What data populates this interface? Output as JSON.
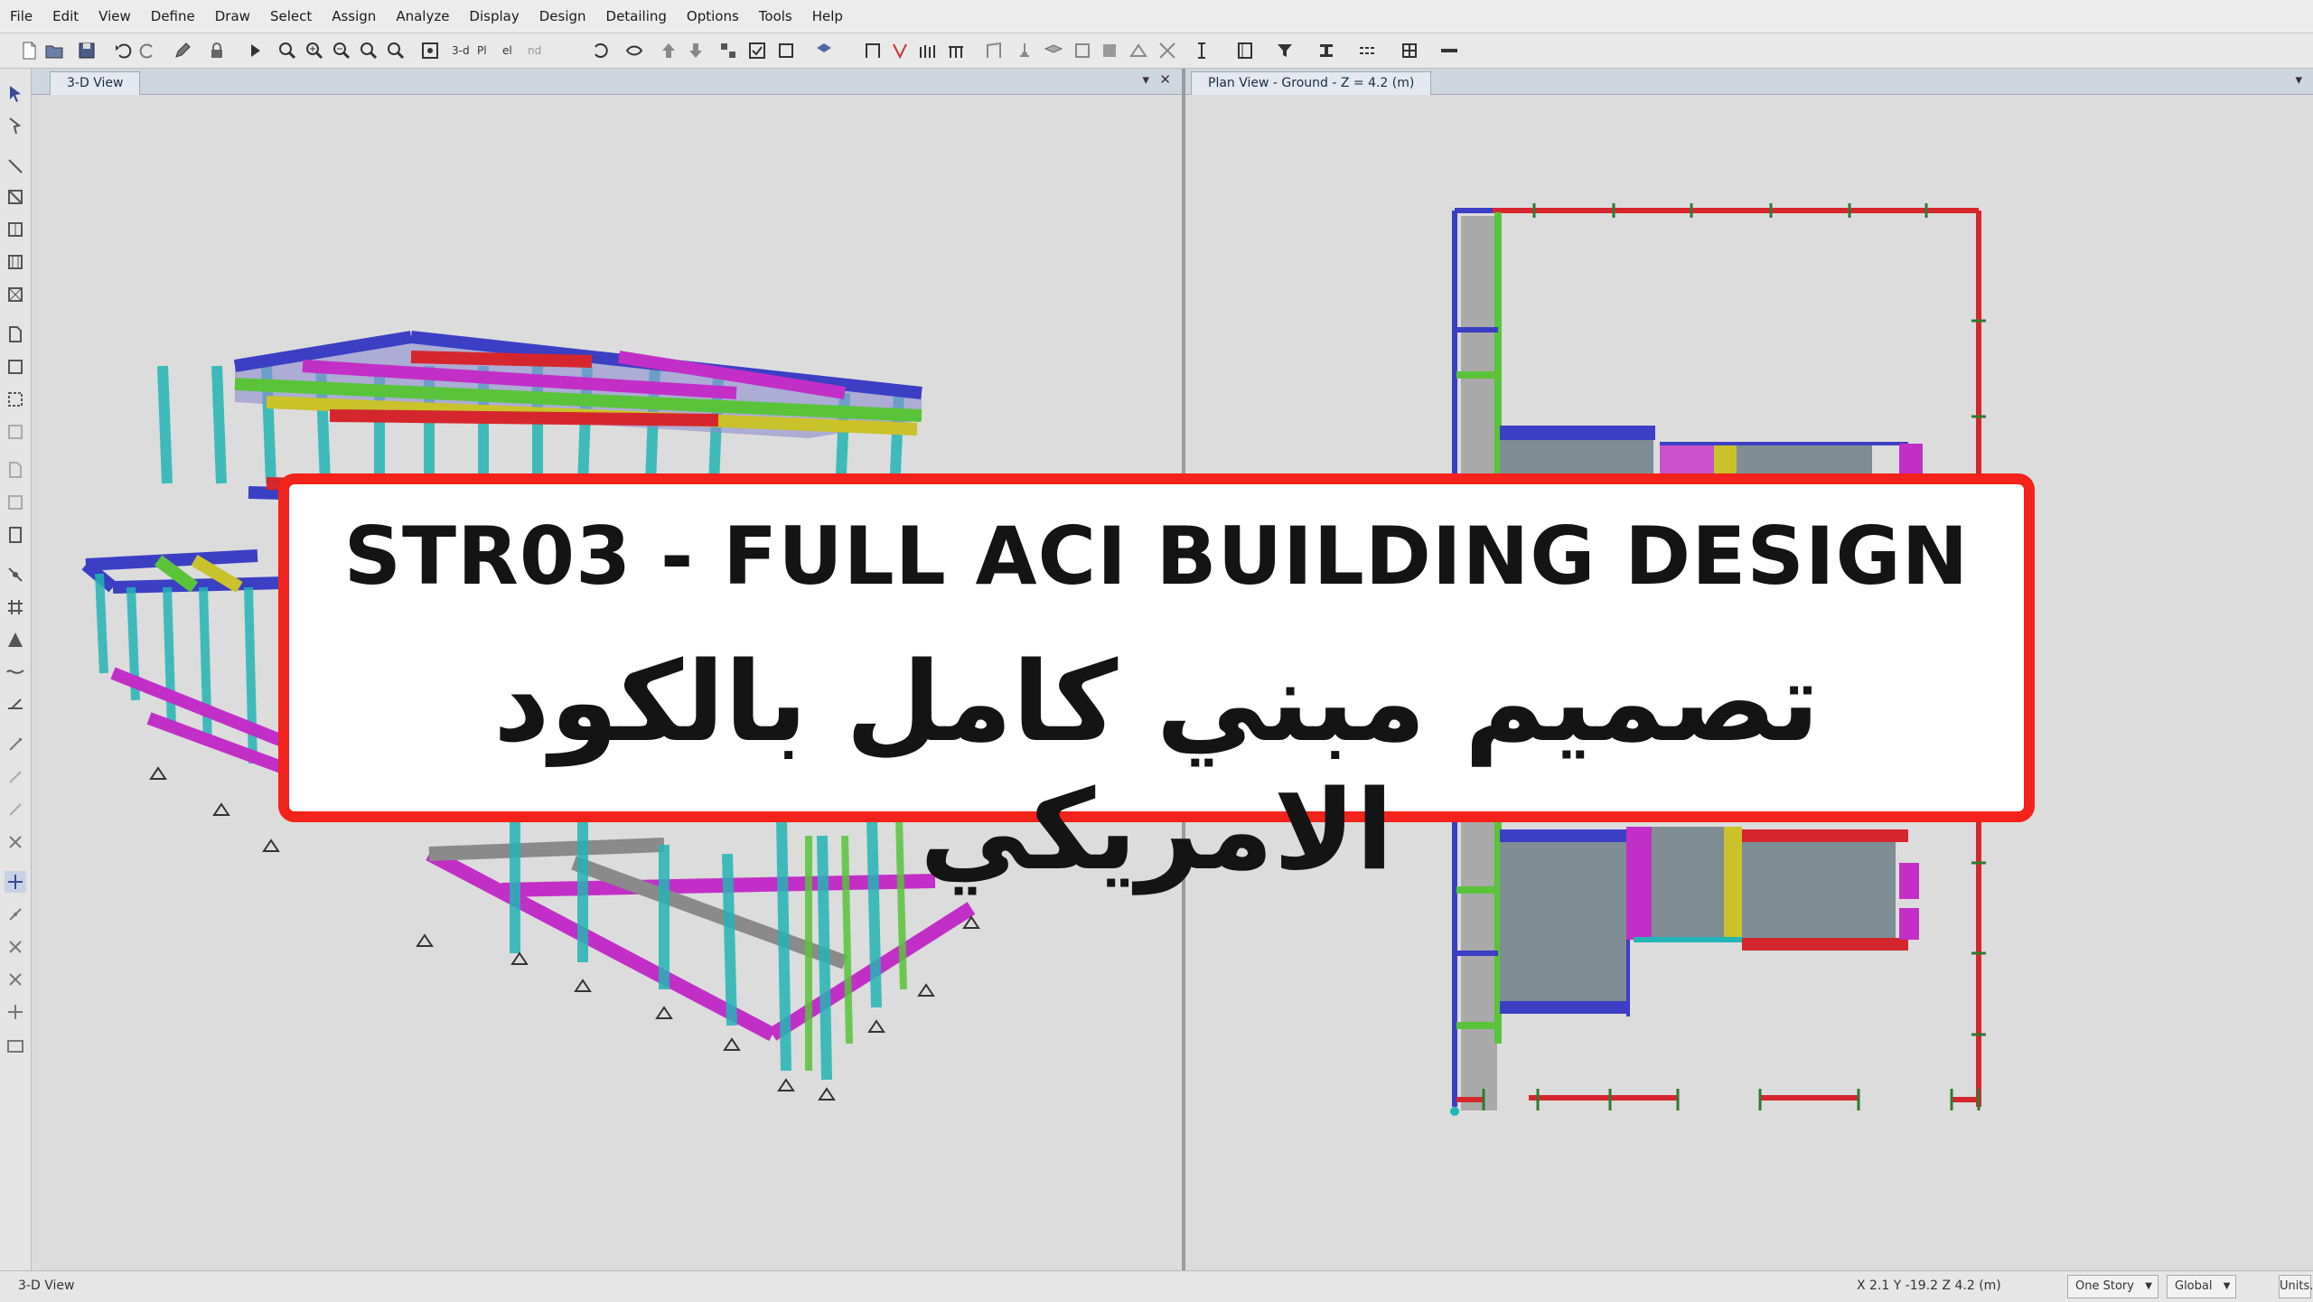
{
  "menu": [
    "File",
    "Edit",
    "View",
    "Define",
    "Draw",
    "Select",
    "Assign",
    "Analyze",
    "Display",
    "Design",
    "Detailing",
    "Options",
    "Tools",
    "Help"
  ],
  "panes": {
    "left": {
      "tab_label": "3-D View",
      "dropdown_glyph": "▾",
      "close_glyph": "✕"
    },
    "right": {
      "tab_label": "Plan View - Ground - Z = 4.2 (m)",
      "dropdown_glyph": "▾"
    }
  },
  "toolbar": {
    "view_3d_label": "3-d",
    "plan_label": "Pl",
    "elev_label": "el",
    "nd_label": "nd"
  },
  "statusbar": {
    "view_label": "3-D View",
    "coordinates": "X 2.1  Y -19.2  Z 4.2 (m)",
    "story_option": "One Story",
    "coord_system": "Global",
    "units_label": "Units..."
  },
  "banner": {
    "title": "STR03 - FULL ACI BUILDING DESIGN",
    "subtitle_ar": "تصميم مبني كامل بالكود الامريكي"
  },
  "colors": {
    "banner_border": "#f3221b",
    "beam_blue": "#3b3fc4",
    "beam_red": "#d6262d",
    "beam_green": "#59c43a",
    "column_cyan": "#23b5b5",
    "beam_magenta": "#c22fc7",
    "beam_yellow": "#c9c22a"
  }
}
